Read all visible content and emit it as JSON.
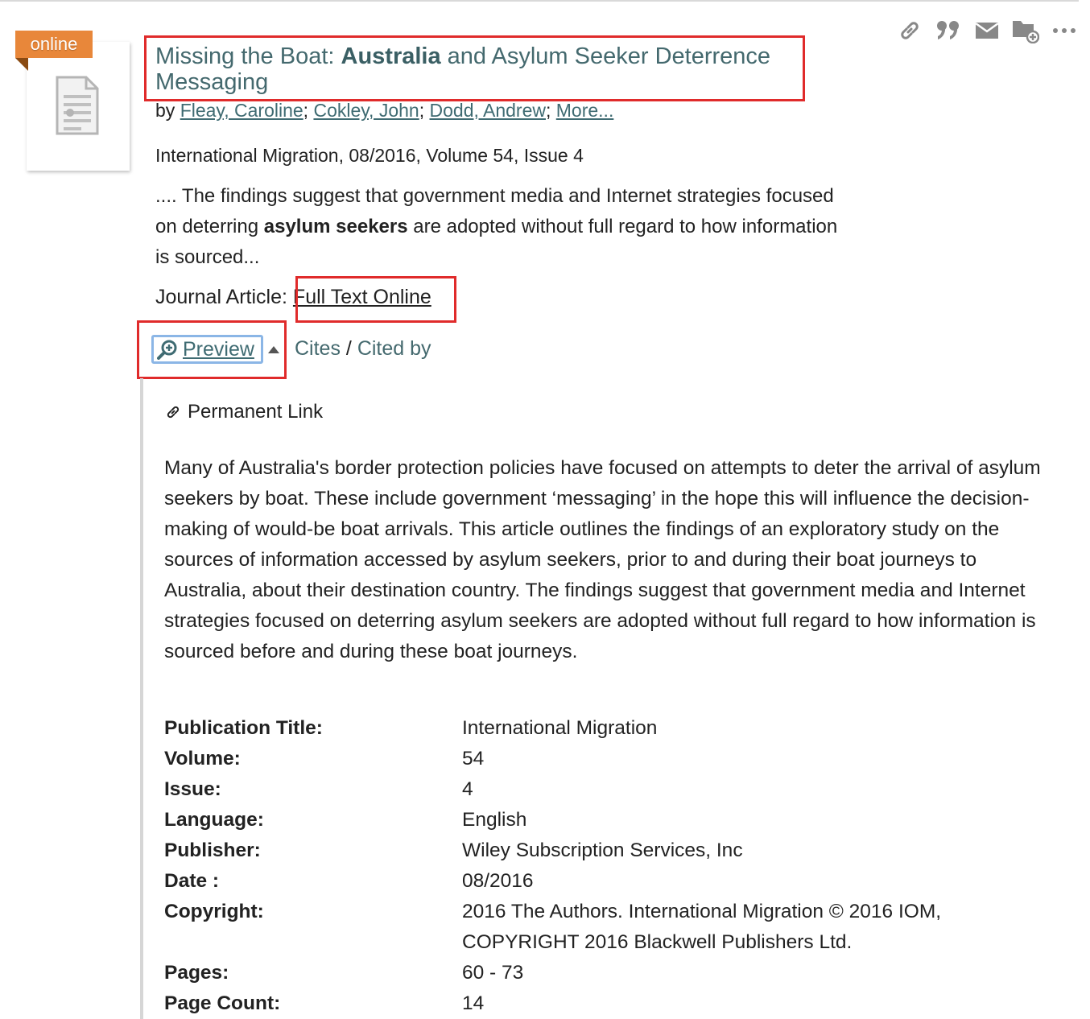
{
  "badge": {
    "label": "online"
  },
  "actions": [
    {
      "name": "permalink-icon"
    },
    {
      "name": "cite-icon"
    },
    {
      "name": "email-icon"
    },
    {
      "name": "save-folder-icon"
    },
    {
      "name": "more-icon"
    }
  ],
  "record": {
    "title_pre": "Missing the Boat: ",
    "title_bold": "Australia",
    "title_post": " and Asylum Seeker Deterrence Messaging",
    "by_label": "by ",
    "authors": [
      "Fleay, Caroline",
      "Cokley, John",
      "Dodd, Andrew"
    ],
    "authors_sep": "; ",
    "more_label": "More...",
    "source": "International Migration, 08/2016, Volume 54, Issue 4",
    "snippet_pre": ".... The findings suggest that government media and Internet strategies focused on deterring ",
    "snippet_bold": "asylum seekers",
    "snippet_post": " are adopted without full regard to how information is sourced...",
    "format_label": "Journal Article: ",
    "full_text_label": "Full Text Online",
    "preview_label": "Preview",
    "cites_label": "Cites",
    "slash": " / ",
    "cited_by_label": "Cited by"
  },
  "preview": {
    "permanent_link_label": "Permanent Link",
    "abstract": "Many of Australia's border protection policies have focused on attempts to deter the arrival of asylum seekers by boat. These include government ‘messaging’ in the hope this will influence the decision-making of would-be boat arrivals. This article outlines the findings of an exploratory study on the sources of information accessed by asylum seekers, prior to and during their boat journeys to Australia, about their destination country. The findings suggest that government media and Internet strategies focused on deterring asylum seekers are adopted without full regard to how information is sourced before and during these boat journeys.",
    "metadata": [
      {
        "key": "Publication Title:",
        "value": "International Migration"
      },
      {
        "key": "Volume:",
        "value": "54"
      },
      {
        "key": "Issue:",
        "value": "4"
      },
      {
        "key": "Language:",
        "value": "English"
      },
      {
        "key": "Publisher:",
        "value": "Wiley Subscription Services, Inc"
      },
      {
        "key": "Date :",
        "value": "08/2016"
      },
      {
        "key": "Copyright:",
        "value": "2016 The Authors. International Migration © 2016 IOM, COPYRIGHT 2016 Blackwell Publishers Ltd."
      },
      {
        "key": "Pages:",
        "value": "60 - 73"
      },
      {
        "key": "Page Count:",
        "value": "14"
      }
    ]
  },
  "colors": {
    "highlight": "#e02b2b",
    "badge": "#e8873a",
    "link": "#3f6b72"
  }
}
